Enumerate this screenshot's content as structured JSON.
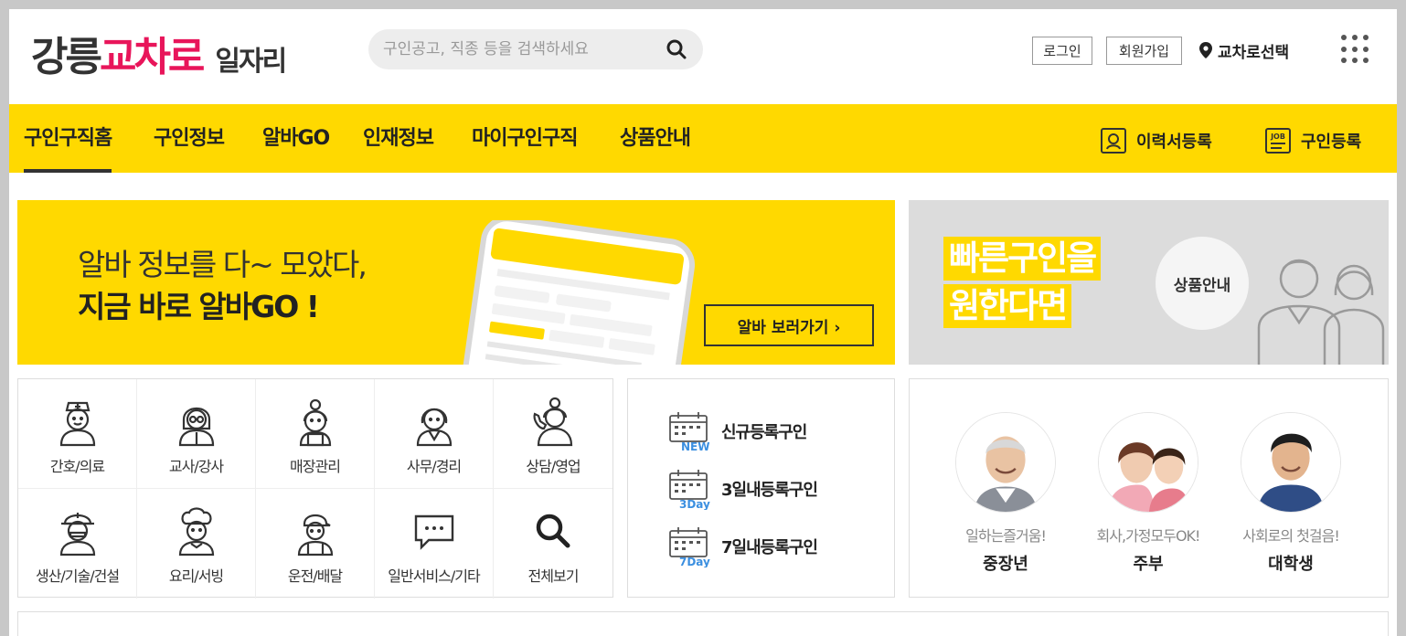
{
  "header": {
    "logo": {
      "part1": "강릉",
      "part2": "교차로",
      "part3": "일자리"
    },
    "search_placeholder": "구인공고, 직종 등을 검색하세요",
    "search_value": "",
    "login_label": "로그인",
    "join_label": "회원가입",
    "region_label": "교차로선택"
  },
  "nav": {
    "items": [
      {
        "label": "구인구직홈",
        "active": true
      },
      {
        "label": "구인정보"
      },
      {
        "label": "알바GO"
      },
      {
        "label": "인재정보"
      },
      {
        "label": "마이구인구직"
      },
      {
        "label": "상품안내"
      }
    ],
    "resume_label": "이력서등록",
    "job_register_label": "구인등록",
    "job_icon_text": "JOB"
  },
  "banner_main": {
    "line1": "알바 정보를 다~ 모았다,",
    "line2": "지금 바로 알바GO !",
    "button_label": "알바 보러가기 ›"
  },
  "banner_side": {
    "line1": "빠른구인을",
    "line2": "원한다면",
    "button_label": "상품안내"
  },
  "categories": [
    {
      "label": "간호/의료",
      "icon": "nurse-icon"
    },
    {
      "label": "교사/강사",
      "icon": "teacher-icon"
    },
    {
      "label": "매장관리",
      "icon": "store-staff-icon"
    },
    {
      "label": "사무/경리",
      "icon": "office-worker-icon"
    },
    {
      "label": "상담/영업",
      "icon": "call-center-icon"
    },
    {
      "label": "생산/기술/건설",
      "icon": "construction-worker-icon"
    },
    {
      "label": "요리/서빙",
      "icon": "chef-icon"
    },
    {
      "label": "운전/배달",
      "icon": "delivery-driver-icon"
    },
    {
      "label": "일반서비스/기타",
      "icon": "chat-bubble-icon"
    },
    {
      "label": "전체보기",
      "icon": "search-icon"
    }
  ],
  "recent": [
    {
      "label": "신규등록구인",
      "badge": "NEW"
    },
    {
      "label": "3일내등록구인",
      "badge": "3Day"
    },
    {
      "label": "7일내등록구인",
      "badge": "7Day"
    }
  ],
  "targets": [
    {
      "sub": "일하는즐거움!",
      "name": "중장년"
    },
    {
      "sub": "회사,가정모두OK!",
      "name": "주부"
    },
    {
      "sub": "사회로의 첫걸음!",
      "name": "대학생"
    }
  ],
  "colors": {
    "brand_yellow": "#ffd900",
    "brand_pink": "#e8155a",
    "badge_blue": "#3b8fe0"
  }
}
